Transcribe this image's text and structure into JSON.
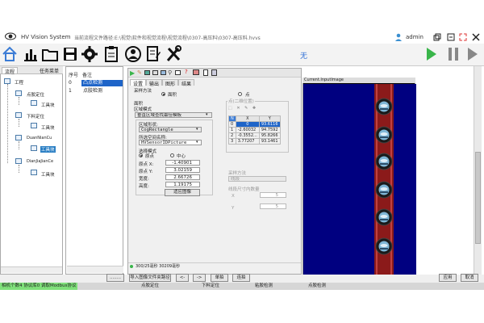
{
  "window": {
    "app_title": "HV Vision System",
    "file_path": "当前流程文件路径:E:\\视觉\\软件和视觉流程\\视觉流程\\0307-高压料\\0307-高压料.hvvs",
    "user": "admin",
    "center_status": "无"
  },
  "tree": {
    "tabs": [
      "流程",
      "任务菜单"
    ],
    "nodes": [
      {
        "label": "工程"
      },
      {
        "label": "点胶定位"
      },
      {
        "label": "工具块"
      },
      {
        "label": "下料定位"
      },
      {
        "label": "工具块"
      },
      {
        "label": "DuanNianCu"
      },
      {
        "label": "工具块"
      },
      {
        "label": "DianJiaJianCe"
      },
      {
        "label": "工具块"
      }
    ]
  },
  "list": {
    "headers": [
      "序号",
      "备注"
    ],
    "rows": [
      {
        "index": "0",
        "note": "凸点检测"
      },
      {
        "index": "1",
        "note": "点胶检测"
      }
    ]
  },
  "settings": {
    "tabs": [
      "设置",
      "输出",
      "图形",
      "结果"
    ],
    "collection_method_label": "采样方法",
    "collection_options": [
      "面积",
      "点"
    ],
    "area_label": "面积",
    "region_mode_label": "区域模式",
    "region_mode_value": "垂直区域查找最佳模板",
    "region_type_label": "区域形状:",
    "region_type_value": "CogRectangle",
    "input_image_label": "所选空间名称:",
    "input_image_value": "HVSensorIDPicture",
    "select_mode_label": "选择模式",
    "select_mode_options": [
      "原点",
      "中心"
    ],
    "origin_x_label": "原点 X:",
    "origin_x_value": "-1.40901",
    "origin_y_label": "原点 Y:",
    "origin_y_value": "3.02159",
    "width_label": "宽度:",
    "width_value": "2.66726",
    "height_label": "高度:",
    "height_value": "1.19175",
    "fit_button": "适应图像",
    "points_group_label": "点(二维位置)",
    "points_table": {
      "headers": [
        "N",
        "X",
        "Y"
      ],
      "rows": [
        [
          "0",
          "0",
          "93.6116"
        ],
        [
          "1",
          "-2.60032",
          "94.7592"
        ],
        [
          "2",
          "-0.3552...",
          "95.8266"
        ],
        [
          "3",
          "3.77207",
          "93.1461"
        ]
      ]
    },
    "sampling_label": "采样方法",
    "sampling_value": "线段",
    "sampling_count_label": "线段尺寸内数量",
    "sampling_x_value": "5",
    "sampling_y_value": "5",
    "status_text": "300/25毫秒 30209毫秒"
  },
  "image_view": {
    "header": "Current.InputImage"
  },
  "bottom": {
    "dots": "........",
    "import_button": "导入图像文件夹路径",
    "prev_button": "<-",
    "next_button": "->",
    "single_button": "单拍",
    "continuous_button": "连拍",
    "apply_button": "应用",
    "cancel_button": "取消"
  },
  "statusbar": {
    "left_text": "相机个数4 协议库0 调取Modbus协议",
    "items": [
      "点胶定位",
      "下料定位",
      "粘胶检测",
      "点胶检测"
    ]
  },
  "colors": {
    "selection": "#1e64c8",
    "status_green": "#7fe07a",
    "image_bg": "#000080",
    "strip_red": "#8b1a1a",
    "run_green": "#39b54a"
  }
}
